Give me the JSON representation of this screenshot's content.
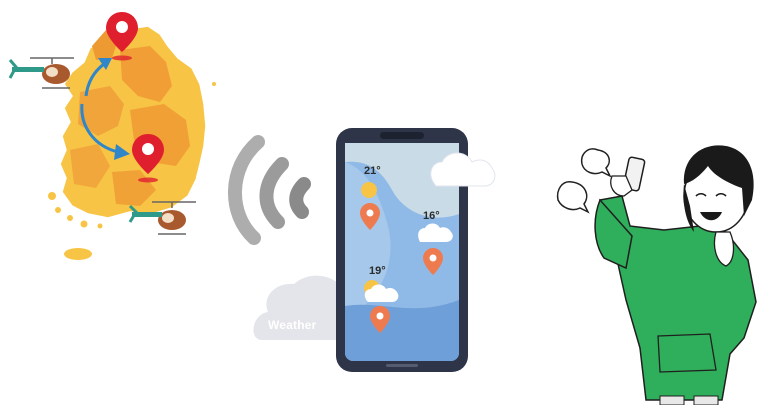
{
  "phone": {
    "readings": [
      {
        "temp": "21°"
      },
      {
        "temp": "16°"
      },
      {
        "temp": "19°"
      }
    ]
  },
  "signal_cloud": {
    "label": "Weather"
  },
  "colors": {
    "map_light": "#f7c445",
    "map_dark": "#ee9a33",
    "pin_red": "#e01f2e",
    "arrow_blue": "#2f86c8",
    "phone_frame": "#2e3548",
    "screen_sky": "#8fb9e6",
    "pin_orange": "#ee7b50",
    "hoodie_green": "#2fae5b"
  },
  "icons": [
    "map-pin-icon",
    "helicopter-icon",
    "wifi-signal-icon",
    "cloud-icon",
    "sun-icon",
    "speech-bubble-icon"
  ]
}
